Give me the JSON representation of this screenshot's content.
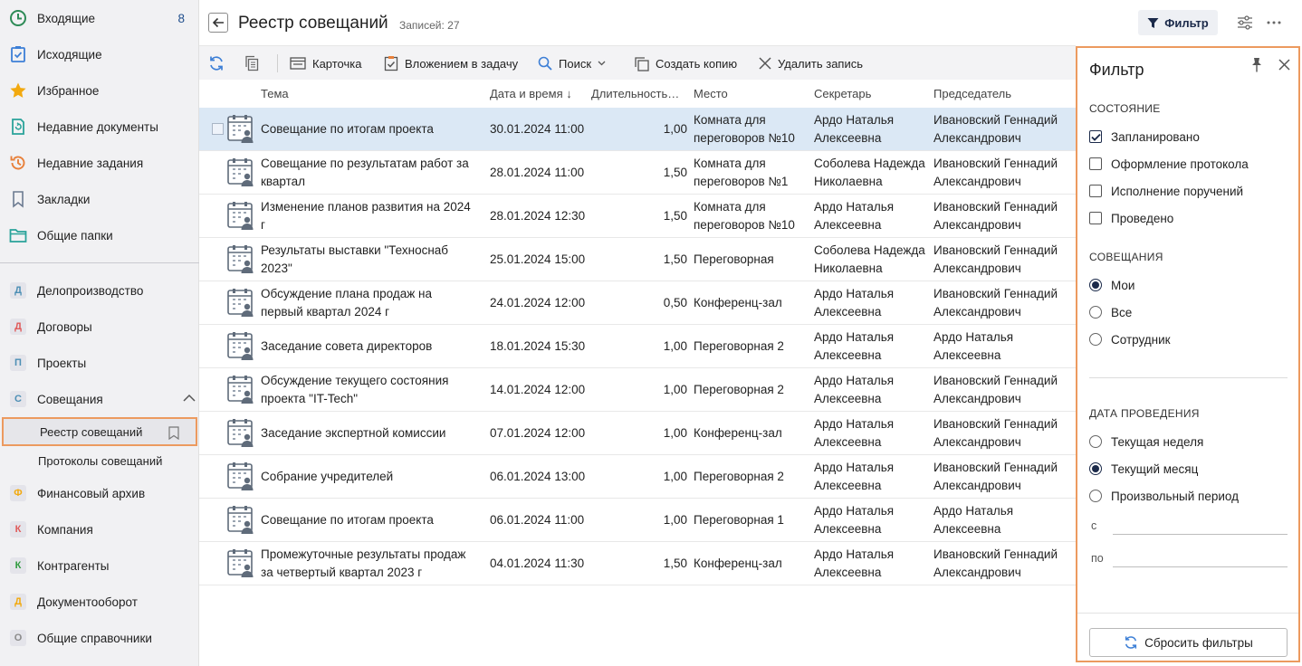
{
  "sidebar": {
    "top_items": [
      {
        "label": "Входящие",
        "count": "8",
        "icon": "clock-icon",
        "color": "#2e8b57"
      },
      {
        "label": "Исходящие",
        "icon": "check-doc-icon",
        "color": "#3d7fd6"
      },
      {
        "label": "Избранное",
        "icon": "star-icon",
        "color": "#f2a90f"
      },
      {
        "label": "Недавние документы",
        "icon": "recent-doc-icon",
        "color": "#2aa39a"
      },
      {
        "label": "Недавние задания",
        "icon": "history-icon",
        "color": "#e8803a"
      },
      {
        "label": "Закладки",
        "icon": "bookmark-icon",
        "color": "#6b7a90"
      },
      {
        "label": "Общие папки",
        "icon": "folder-icon",
        "color": "#2aa39a"
      }
    ],
    "modules": [
      {
        "label": "Делопроизводство",
        "letter": "Д",
        "color": "#4d8fb5"
      },
      {
        "label": "Договоры",
        "letter": "Д",
        "color": "#e05a5a"
      },
      {
        "label": "Проекты",
        "letter": "П",
        "color": "#4d8fb5"
      },
      {
        "label": "Совещания",
        "letter": "С",
        "color": "#4d8fb5"
      }
    ],
    "sub_items": [
      {
        "label": "Реестр совещаний"
      },
      {
        "label": "Протоколы совещаний"
      }
    ],
    "modules2": [
      {
        "label": "Финансовый архив",
        "letter": "Ф",
        "color": "#f2a90f"
      },
      {
        "label": "Компания",
        "letter": "К",
        "color": "#e05a5a"
      },
      {
        "label": "Контрагенты",
        "letter": "К",
        "color": "#2e9b3e"
      },
      {
        "label": "Документооборот",
        "letter": "Д",
        "color": "#f2a90f"
      },
      {
        "label": "Общие справочники",
        "letter": "О",
        "color": "#8a8a8a"
      }
    ]
  },
  "header": {
    "title": "Реестр совещаний",
    "record_count": "Записей: 27",
    "filter_label": "Фильтр"
  },
  "toolbar": {
    "card": "Карточка",
    "attach": "Вложением в задачу",
    "search": "Поиск",
    "copy": "Создать копию",
    "delete": "Удалить запись"
  },
  "table": {
    "columns": [
      "Тема",
      "Дата и время",
      "Длительность…",
      "Место",
      "Секретарь",
      "Председатель"
    ],
    "sort_indicator": "↓",
    "rows": [
      {
        "topic": [
          "Совещание по итогам проекта"
        ],
        "date": "30.01.2024 11:00",
        "duration": "1,00",
        "place": [
          "Комната для",
          "переговоров №10"
        ],
        "secretary": [
          "Ардо Наталья",
          "Алексеевна"
        ],
        "chair": [
          "Ивановский Геннадий",
          "Александрович"
        ],
        "selected": true
      },
      {
        "topic": [
          "Совещание по результатам работ за",
          "квартал"
        ],
        "date": "28.01.2024 11:00",
        "duration": "1,50",
        "place": [
          "Комната для",
          "переговоров №1"
        ],
        "secretary": [
          "Соболева Надежда",
          "Николаевна"
        ],
        "chair": [
          "Ивановский Геннадий",
          "Александрович"
        ]
      },
      {
        "topic": [
          "Изменение планов развития на 2024",
          "г"
        ],
        "date": "28.01.2024 12:30",
        "duration": "1,50",
        "place": [
          "Комната для",
          "переговоров №10"
        ],
        "secretary": [
          "Ардо Наталья",
          "Алексеевна"
        ],
        "chair": [
          "Ивановский Геннадий",
          "Александрович"
        ]
      },
      {
        "topic": [
          "Результаты выставки \"Техноснаб",
          "2023\""
        ],
        "date": "25.01.2024 15:00",
        "duration": "1,50",
        "place": [
          "Переговорная"
        ],
        "secretary": [
          "Соболева Надежда",
          "Николаевна"
        ],
        "chair": [
          "Ивановский Геннадий",
          "Александрович"
        ]
      },
      {
        "topic": [
          "Обсуждение плана продаж на",
          "первый квартал 2024 г"
        ],
        "date": "24.01.2024 12:00",
        "duration": "0,50",
        "place": [
          "Конференц-зал"
        ],
        "secretary": [
          "Ардо Наталья",
          "Алексеевна"
        ],
        "chair": [
          "Ивановский Геннадий",
          "Александрович"
        ]
      },
      {
        "topic": [
          "Заседание совета директоров"
        ],
        "date": "18.01.2024 15:30",
        "duration": "1,00",
        "place": [
          "Переговорная 2"
        ],
        "secretary": [
          "Ардо Наталья",
          "Алексеевна"
        ],
        "chair": [
          "Ардо Наталья",
          "Алексеевна"
        ]
      },
      {
        "topic": [
          "Обсуждение текущего состояния",
          "проекта \"IT-Tech\""
        ],
        "date": "14.01.2024 12:00",
        "duration": "1,00",
        "place": [
          "Переговорная 2"
        ],
        "secretary": [
          "Ардо Наталья",
          "Алексеевна"
        ],
        "chair": [
          "Ивановский Геннадий",
          "Александрович"
        ]
      },
      {
        "topic": [
          "Заседание экспертной комиссии"
        ],
        "date": "07.01.2024 12:00",
        "duration": "1,00",
        "place": [
          "Конференц-зал"
        ],
        "secretary": [
          "Ардо Наталья",
          "Алексеевна"
        ],
        "chair": [
          "Ивановский Геннадий",
          "Александрович"
        ]
      },
      {
        "topic": [
          "Собрание учредителей"
        ],
        "date": "06.01.2024 13:00",
        "duration": "1,00",
        "place": [
          "Переговорная 2"
        ],
        "secretary": [
          "Ардо Наталья",
          "Алексеевна"
        ],
        "chair": [
          "Ивановский Геннадий",
          "Александрович"
        ]
      },
      {
        "topic": [
          "Совещание по итогам проекта"
        ],
        "date": "06.01.2024 11:00",
        "duration": "1,00",
        "place": [
          "Переговорная 1"
        ],
        "secretary": [
          "Ардо Наталья",
          "Алексеевна"
        ],
        "chair": [
          "Ардо Наталья",
          "Алексеевна"
        ]
      },
      {
        "topic": [
          "Промежуточные результаты продаж",
          "за четвертый квартал 2023 г"
        ],
        "date": "04.01.2024 11:30",
        "duration": "1,50",
        "place": [
          "Конференц-зал"
        ],
        "secretary": [
          "Ардо Наталья",
          "Алексеевна"
        ],
        "chair": [
          "Ивановский Геннадий",
          "Александрович"
        ]
      }
    ]
  },
  "filter": {
    "title": "Фильтр",
    "state_title": "СОСТОЯНИЕ",
    "states": [
      {
        "label": "Запланировано",
        "checked": true
      },
      {
        "label": "Оформление протокола",
        "checked": false
      },
      {
        "label": "Исполнение поручений",
        "checked": false
      },
      {
        "label": "Проведено",
        "checked": false
      }
    ],
    "meetings_title": "СОВЕЩАНИЯ",
    "meetings": [
      {
        "label": "Мои",
        "checked": true
      },
      {
        "label": "Все",
        "checked": false
      },
      {
        "label": "Сотрудник",
        "checked": false
      }
    ],
    "date_title": "ДАТА ПРОВЕДЕНИЯ",
    "dates": [
      {
        "label": "Текущая неделя",
        "checked": false
      },
      {
        "label": "Текущий месяц",
        "checked": true
      },
      {
        "label": "Произвольный период",
        "checked": false
      }
    ],
    "from_label": "с",
    "to_label": "по",
    "reset_label": "Сбросить фильтры"
  },
  "colors": {
    "accent_orange": "#ec9a5f",
    "selected_row": "#dbe8f5",
    "dark_navy": "#1b2a4a"
  }
}
